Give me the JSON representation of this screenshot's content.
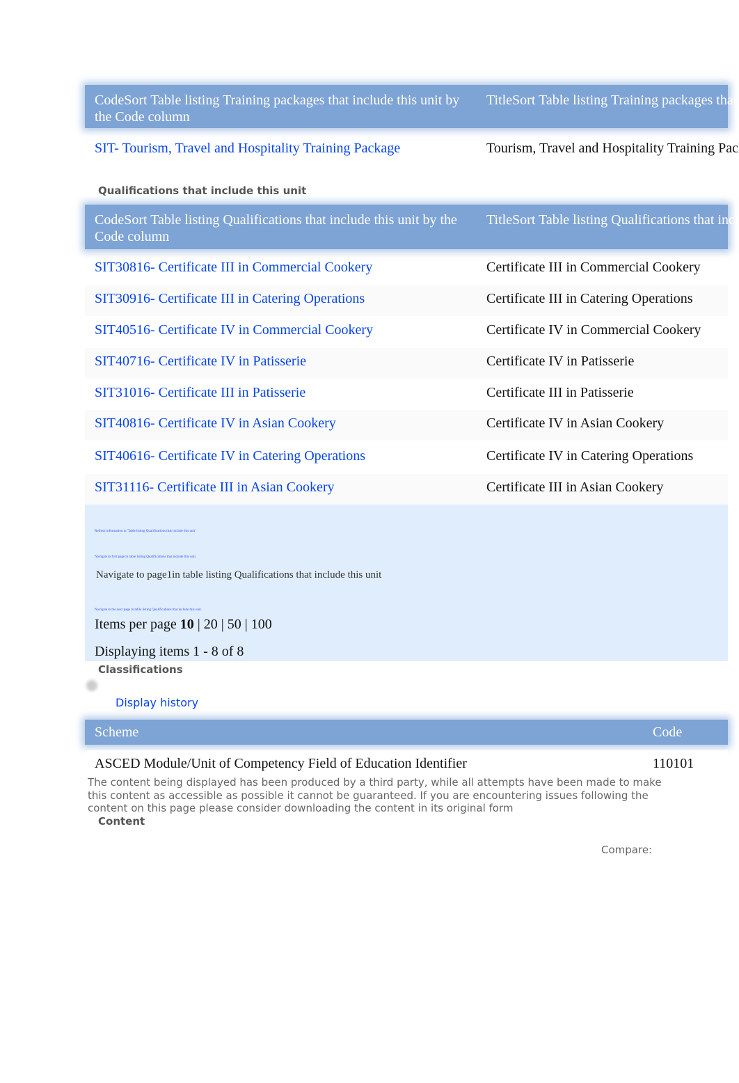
{
  "training_packages": {
    "headers": {
      "code": "CodeSort Table listing Training packages that include this unit by the Code column",
      "title": "TitleSort Table listing Training packages that include this unit by the Title column"
    },
    "rows": [
      {
        "code": "SIT- Tourism, Travel and Hospitality Training Package",
        "title": "Tourism, Travel and Hospitality Training Package"
      }
    ]
  },
  "qualifications": {
    "section_title": "Qualifications that include this unit",
    "headers": {
      "code": "CodeSort Table listing Qualifications that include this unit by the Code column",
      "title": "TitleSort Table listing Qualifications that include this unit by the Title column"
    },
    "rows": [
      {
        "code": "SIT30816- Certificate III in Commercial Cookery",
        "title": "Certificate III in Commercial Cookery"
      },
      {
        "code": "SIT30916- Certificate III in Catering Operations",
        "title": "Certificate III in Catering Operations"
      },
      {
        "code": "SIT40516- Certificate IV in Commercial Cookery",
        "title": "Certificate IV in Commercial Cookery"
      },
      {
        "code": "SIT40716- Certificate IV in Patisserie",
        "title": "Certificate IV in Patisserie"
      },
      {
        "code": "SIT31016- Certificate III in Patisserie",
        "title": "Certificate III in Patisserie"
      },
      {
        "code": "SIT40816- Certificate IV in Asian Cookery",
        "title": "Certificate IV in Asian Cookery"
      },
      {
        "code": "SIT40616- Certificate IV in Catering Operations",
        "title": "Certificate IV in Catering Operations"
      },
      {
        "code": "SIT31116- Certificate III in Asian Cookery",
        "title": "Certificate III in Asian Cookery"
      }
    ],
    "pager": {
      "refresh": "Refresh information in 'Table listing Qualifications that include this unit'",
      "first_page": "Navigate to first page in table listing Qualifications that include this unit.",
      "page1": "Navigate to page1in table listing Qualifications that include this unit",
      "next_page": "Navigate to the next page in table listing Qualifications that include this unit.",
      "items_per_page_label": "Items per page",
      "items_per_page_options": [
        "10",
        "20",
        "50",
        "100"
      ],
      "displaying": "Displaying items 1 - 8 of 8"
    }
  },
  "classifications": {
    "section_title": "Classifications",
    "display_history": "Display history",
    "headers": {
      "scheme": "Scheme",
      "code": "Code"
    },
    "rows": [
      {
        "scheme": "ASCED Module/Unit of Competency Field of Education Identifier",
        "code": "110101"
      }
    ]
  },
  "disclaimer": "The content being displayed has been produced by a third party, while all attempts have been made to make this content as accessible as possible it cannot be guaranteed. If you are encountering issues following the content on this page please consider downloading the content in its original form",
  "content": {
    "section_title": "Content",
    "compare_label": "Compare:"
  }
}
